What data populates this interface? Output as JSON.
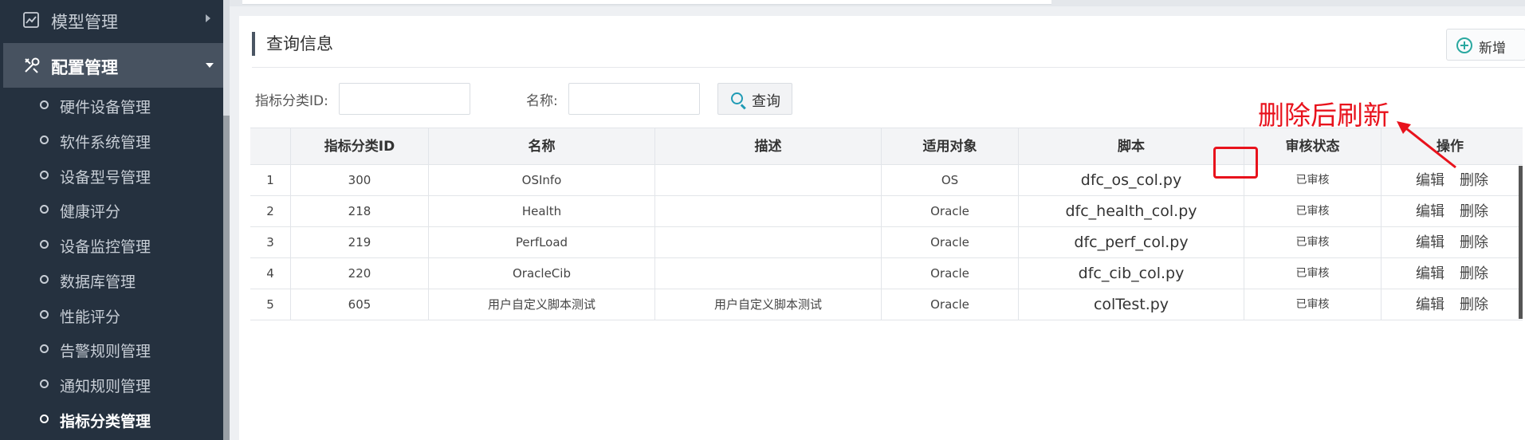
{
  "sidebar": {
    "top_item": {
      "label": "模型管理",
      "icon": "chart-icon"
    },
    "active_group": {
      "label": "配置管理",
      "icon": "tools-icon"
    },
    "items": [
      {
        "label": "硬件设备管理"
      },
      {
        "label": "软件系统管理"
      },
      {
        "label": "设备型号管理"
      },
      {
        "label": "健康评分"
      },
      {
        "label": "设备监控管理"
      },
      {
        "label": "数据库管理"
      },
      {
        "label": "性能评分"
      },
      {
        "label": "告警规则管理"
      },
      {
        "label": "通知规则管理"
      },
      {
        "label": "指标分类管理"
      }
    ]
  },
  "panel": {
    "title": "查询信息",
    "add_label": "新增"
  },
  "filters": {
    "category_id_label": "指标分类ID:",
    "category_id_value": "",
    "name_label": "名称:",
    "name_value": "",
    "query_label": "查询"
  },
  "table": {
    "columns": [
      "",
      "指标分类ID",
      "名称",
      "描述",
      "适用对象",
      "脚本",
      "审核状态",
      "操作"
    ],
    "rows": [
      {
        "index": "1",
        "id": "300",
        "name": "OSInfo",
        "desc": "",
        "target": "OS",
        "script": "dfc_os_col.py",
        "status": "已审核",
        "edit": "编辑",
        "delete": "删除"
      },
      {
        "index": "2",
        "id": "218",
        "name": "Health",
        "desc": "",
        "target": "Oracle",
        "script": "dfc_health_col.py",
        "status": "已审核",
        "edit": "编辑",
        "delete": "删除"
      },
      {
        "index": "3",
        "id": "219",
        "name": "PerfLoad",
        "desc": "",
        "target": "Oracle",
        "script": "dfc_perf_col.py",
        "status": "已审核",
        "edit": "编辑",
        "delete": "删除"
      },
      {
        "index": "4",
        "id": "220",
        "name": "OracleCib",
        "desc": "",
        "target": "Oracle",
        "script": "dfc_cib_col.py",
        "status": "已审核",
        "edit": "编辑",
        "delete": "删除"
      },
      {
        "index": "5",
        "id": "605",
        "name": "用户自定义脚本测试",
        "desc": "用户自定义脚本测试",
        "target": "Oracle",
        "script": "colTest.py",
        "status": "已审核",
        "edit": "编辑",
        "delete": "删除"
      }
    ]
  },
  "annotation": {
    "text": "删除后刷新",
    "color": "#e8121c"
  }
}
